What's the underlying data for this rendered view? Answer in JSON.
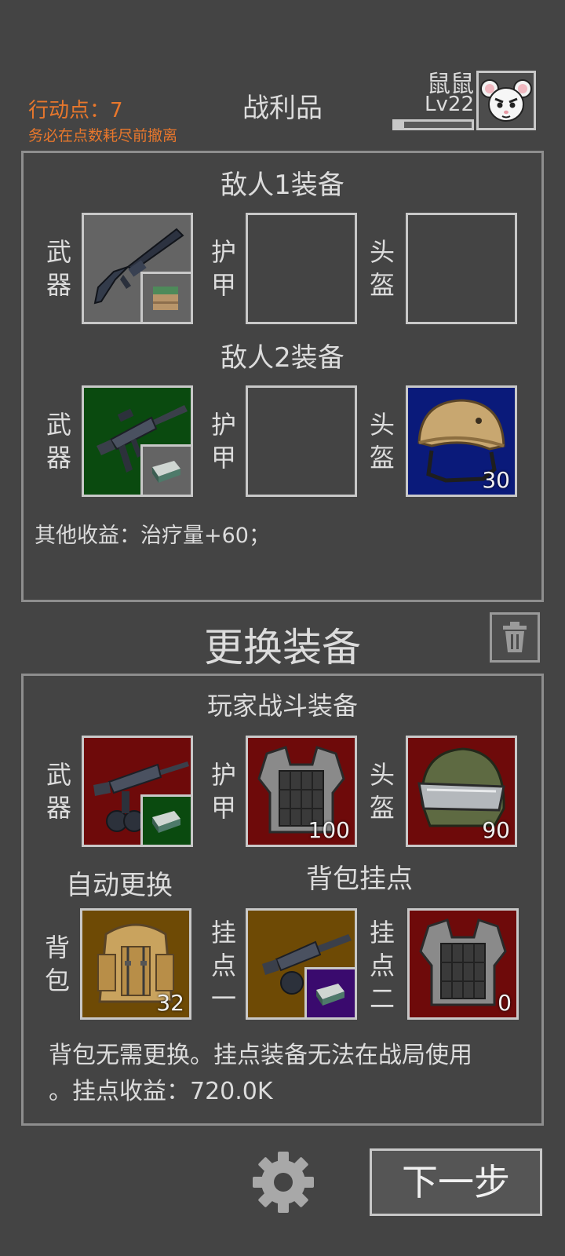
{
  "status": {
    "action_points_label": "行动点：7",
    "evacuate_note": "务必在点数耗尽前撤离"
  },
  "header": {
    "title": "战利品"
  },
  "player": {
    "name": "鼠鼠",
    "level": "Lv22",
    "xp_progress": 0.12,
    "avatar_icon": "white-mouse-face-icon"
  },
  "loot": {
    "enemy1": {
      "title": "敌人1装备",
      "weapon_label": "武器",
      "armor_label": "护甲",
      "helmet_label": "头盔",
      "weapon_icon": "shotgun-icon",
      "weapon_ammo_icon": "ammo-crate-icon"
    },
    "enemy2": {
      "title": "敌人2装备",
      "weapon_label": "武器",
      "armor_label": "护甲",
      "helmet_label": "头盔",
      "weapon_icon": "smg-icon",
      "weapon_ammo_icon": "ammo-box-icon",
      "helmet_icon": "tan-combat-helmet-icon",
      "helmet_durability": "30"
    },
    "other_gains": "其他收益：治疗量+60；"
  },
  "swap": {
    "title": "更换装备",
    "trash_icon": "trash-icon"
  },
  "player_gear": {
    "title": "玩家战斗装备",
    "weapon_label": "武器",
    "armor_label": "护甲",
    "helmet_label": "头盔",
    "weapon_icon": "drum-mag-rifle-icon",
    "weapon_ammo_icon": "ammo-box-icon",
    "armor_icon": "plate-carrier-icon",
    "armor_durability": "100",
    "helmet_icon": "visor-helmet-icon",
    "helmet_durability": "90",
    "auto_swap_label": "自动更换",
    "backpack_mounts_title": "背包挂点",
    "backpack_label": "背包",
    "backpack_icon": "tan-backpack-icon",
    "backpack_value": "32",
    "mount1_label": "挂点一",
    "mount1_icon": "drum-mag-smg-icon",
    "mount1_ammo_icon": "ammo-box-icon",
    "mount2_label": "挂点二",
    "mount2_icon": "plate-carrier-icon",
    "mount2_value": "0",
    "note": "背包无需更换。挂点装备无法在战局使用。挂点收益：720.0K",
    "note_line1": "背包无需更换。挂点装备无法在战局使用",
    "note_line2": "。挂点收益：720.0K"
  },
  "footer": {
    "settings_icon": "gear-icon",
    "next_label": "下一步"
  },
  "colors": {
    "background": "#444444",
    "accent_orange": "#e8772c",
    "rarity_green": "#0a4a0f",
    "rarity_blue": "#0a1a7a",
    "rarity_red": "#6e0a0a",
    "rarity_gold": "#6e4a05",
    "rarity_purple": "#3a0a6e"
  }
}
